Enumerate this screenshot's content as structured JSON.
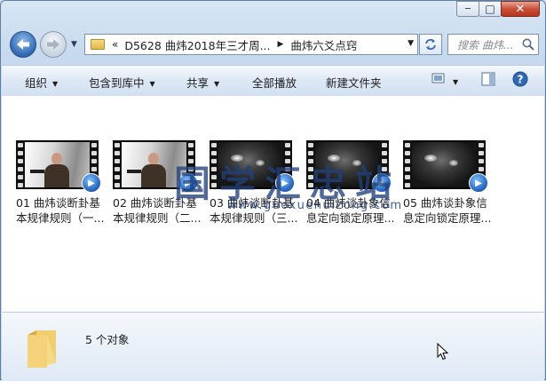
{
  "window": {
    "caption": {
      "minimize_glyph": "─",
      "maximize_glyph": "□",
      "close_glyph": "✕"
    }
  },
  "address_bar": {
    "overflow": "«",
    "segments": [
      "D5628 曲炜2018年三才周...",
      "曲炜六爻点窍"
    ],
    "segment_sep": "▶",
    "dropdown": "▼"
  },
  "search": {
    "placeholder": "搜索 曲炜..."
  },
  "toolbar": {
    "organize": "组织",
    "include_in_library": "包含到库中",
    "share": "共享",
    "play_all": "全部播放",
    "new_folder": "新建文件夹",
    "dropdown_arrow": "▼"
  },
  "files": [
    {
      "line1": "01 曲炜谈断卦基",
      "line2": "本规律规则（一...",
      "thumb": "person"
    },
    {
      "line1": "02 曲炜谈断卦基",
      "line2": "本规律规则（二...",
      "thumb": "person"
    },
    {
      "line1": "03 曲炜谈断卦基",
      "line2": "本规律规则（三...",
      "thumb": "dark"
    },
    {
      "line1": "04 曲炜谈卦象信",
      "line2": "息定向锁定原理...",
      "thumb": "dark"
    },
    {
      "line1": "05 曲炜谈卦象信",
      "line2": "息定向锁定原理...",
      "thumb": "dark"
    }
  ],
  "watermark": {
    "text": "国学汇忠站",
    "url": "www.guoxuehuizong.com"
  },
  "details": {
    "count_text": "5 个对象"
  },
  "colors": {
    "window_frame": "#c6d9ee",
    "toolbar": "#dde8f5",
    "accent_blue": "#2f69b5",
    "close_red": "#c9503a"
  }
}
